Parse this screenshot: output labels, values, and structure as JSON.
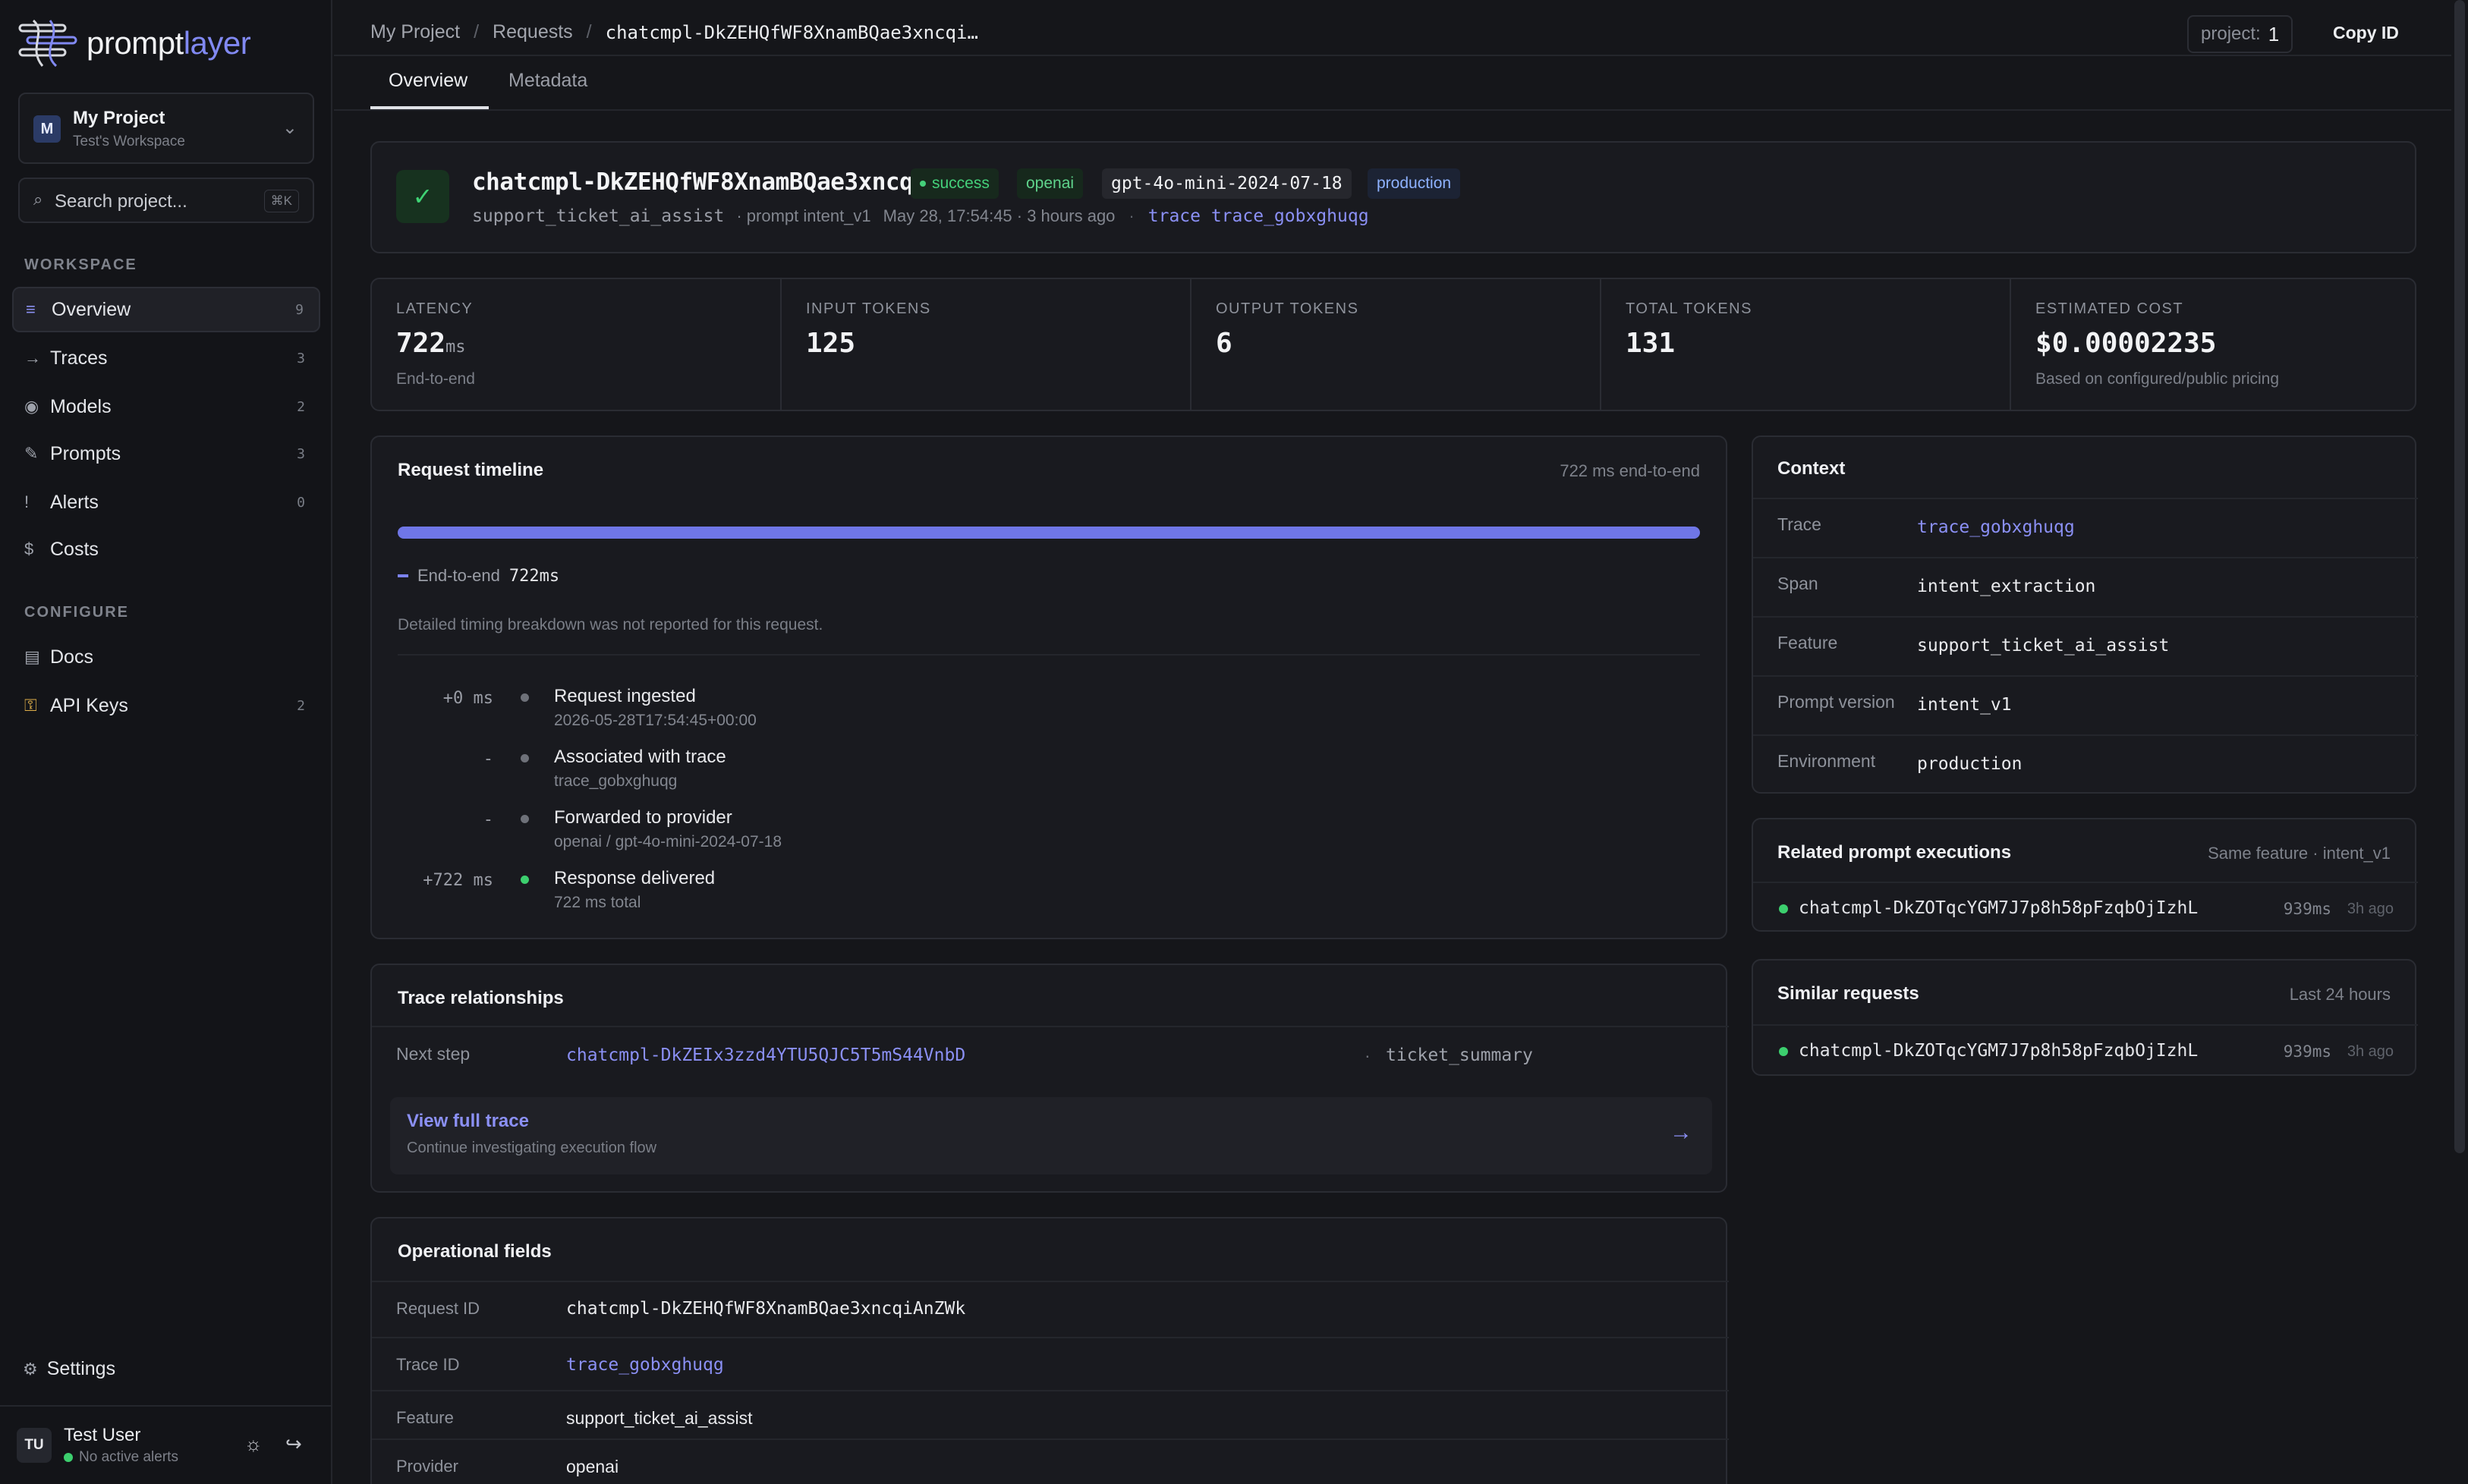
{
  "brand": {
    "prefix": "prompt",
    "suffix": "layer"
  },
  "project": {
    "avatar": "M",
    "name": "My Project",
    "workspace": "Test's Workspace"
  },
  "search": {
    "placeholder": "Search project...",
    "shortcut": "⌘K"
  },
  "sidebar": {
    "workspace_label": "WORKSPACE",
    "configure_label": "CONFIGURE",
    "workspace_items": [
      {
        "label": "Overview",
        "count": "9",
        "icon": "list-icon"
      },
      {
        "label": "Traces",
        "count": "3",
        "icon": "arrow-icon"
      },
      {
        "label": "Models",
        "count": "2",
        "icon": "circle-icon"
      },
      {
        "label": "Prompts",
        "count": "3",
        "icon": "pencil-icon"
      },
      {
        "label": "Alerts",
        "count": "0",
        "icon": "alert-icon"
      },
      {
        "label": "Costs",
        "count": "",
        "icon": "dollar-icon"
      }
    ],
    "configure_items": [
      {
        "label": "Docs",
        "count": "",
        "icon": "book-icon"
      },
      {
        "label": "API Keys",
        "count": "2",
        "icon": "key-icon"
      }
    ],
    "settings_label": "Settings"
  },
  "user": {
    "initials": "TU",
    "name": "Test User",
    "status": "No active alerts"
  },
  "breadcrumb": {
    "items": [
      "My Project",
      "Requests"
    ],
    "current": "chatcmpl-DkZEHQfWF8XnamBQae3xncqi…"
  },
  "topbar": {
    "project_label": "project:",
    "project_value": "1",
    "copy_label": "Copy ID"
  },
  "tabs": [
    "Overview",
    "Metadata"
  ],
  "request": {
    "title": "chatcmpl-DkZEHQfWF8XnamBQae3xncq…",
    "status": "success",
    "provider": "openai",
    "model": "gpt-4o-mini-2024-07-18",
    "environment": "production",
    "feature": "support_ticket_ai_assist",
    "prompt": "· prompt intent_v1",
    "time": "May 28, 17:54:45 · 3 hours ago",
    "sep": "·",
    "trace": "trace trace_gobxghuqg"
  },
  "stats": [
    {
      "label": "LATENCY",
      "value": "722",
      "unit": "ms",
      "note": "End-to-end"
    },
    {
      "label": "INPUT TOKENS",
      "value": "125",
      "unit": "",
      "note": ""
    },
    {
      "label": "OUTPUT TOKENS",
      "value": "6",
      "unit": "",
      "note": ""
    },
    {
      "label": "TOTAL TOKENS",
      "value": "131",
      "unit": "",
      "note": ""
    },
    {
      "label": "ESTIMATED COST",
      "value": "$0.00002235",
      "unit": "",
      "note": "Based on configured/public pricing"
    }
  ],
  "timeline": {
    "title": "Request timeline",
    "subtitle": "722 ms end-to-end",
    "progress": 1.0,
    "legend_label": "End-to-end",
    "legend_value": "722ms",
    "note": "Detailed timing breakdown was not reported for this request.",
    "events": [
      {
        "offset": "+0 ms",
        "title": "Request ingested",
        "sub": "2026-05-28T17:54:45+00:00",
        "status": "gray"
      },
      {
        "offset": "-",
        "title": "Associated with trace",
        "sub": "trace_gobxghuqg",
        "status": "gray"
      },
      {
        "offset": "-",
        "title": "Forwarded to provider",
        "sub": "openai / gpt-4o-mini-2024-07-18",
        "status": "gray"
      },
      {
        "offset": "+722 ms",
        "title": "Response delivered",
        "sub": "722 ms total",
        "status": "green"
      }
    ]
  },
  "context": {
    "title": "Context",
    "rows": [
      {
        "key": "Trace",
        "value": "trace_gobxghuqg",
        "link": true
      },
      {
        "key": "Span",
        "value": "intent_extraction",
        "link": false
      },
      {
        "key": "Feature",
        "value": "support_ticket_ai_assist",
        "link": false
      },
      {
        "key": "Prompt version",
        "value": "intent_v1",
        "link": false
      },
      {
        "key": "Environment",
        "value": "production",
        "link": false
      }
    ]
  },
  "related": {
    "title": "Related prompt executions",
    "subtitle": "Same feature · intent_v1",
    "items": [
      {
        "id": "chatcmpl-DkZOTqcYGM7J7p8h58pFzqbOjIzhL",
        "ms": "939ms",
        "ago": "3h ago"
      }
    ]
  },
  "similar": {
    "title": "Similar requests",
    "subtitle": "Last 24 hours",
    "items": [
      {
        "id": "chatcmpl-DkZOTqcYGM7J7p8h58pFzqbOjIzhL",
        "ms": "939ms",
        "ago": "3h ago"
      }
    ]
  },
  "trace_rel": {
    "title": "Trace relationships",
    "next_label": "Next step",
    "next_id": "chatcmpl-DkZEIx3zzd4YTU5QJC5T5mS44VnbD",
    "next_sep": "·",
    "next_name": "ticket_summary",
    "view_title": "View full trace",
    "view_sub": "Continue investigating execution flow"
  },
  "operational": {
    "title": "Operational fields",
    "rows": [
      {
        "key": "Request ID",
        "value": "chatcmpl-DkZEHQfWF8XnamBQae3xncqiAnZWk",
        "style": "m"
      },
      {
        "key": "Trace ID",
        "value": "trace_gobxghuqg",
        "style": "link"
      },
      {
        "key": "Feature",
        "value": "support_ticket_ai_assist",
        "style": ""
      },
      {
        "key": "Provider",
        "value": "openai",
        "style": ""
      }
    ]
  },
  "colors": {
    "accent": "#8b90f5",
    "success": "#3ccf6e",
    "background": "#15161a"
  }
}
